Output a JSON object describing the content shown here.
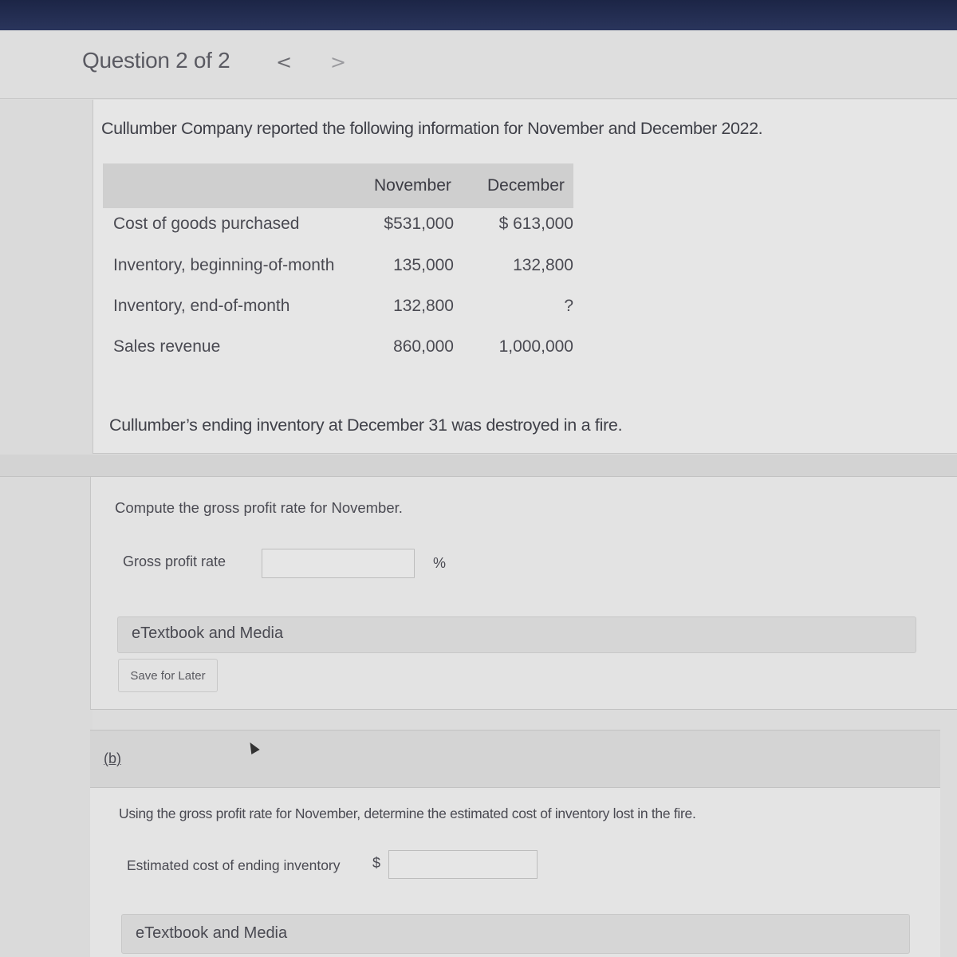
{
  "header": {
    "question_counter": "Question 2 of 2",
    "prev_icon": "<",
    "next_icon": ">"
  },
  "problem": {
    "intro": "Cullumber Company reported the following information for November and December 2022.",
    "table": {
      "columns": [
        "November",
        "December"
      ],
      "rows": [
        {
          "label": "Cost of goods purchased",
          "november": "$531,000",
          "december": "$ 613,000"
        },
        {
          "label": "Inventory, beginning-of-month",
          "november": "135,000",
          "december": "132,800"
        },
        {
          "label": "Inventory, end-of-month",
          "november": "132,800",
          "december": "?"
        },
        {
          "label": "Sales revenue",
          "november": "860,000",
          "december": "1,000,000"
        }
      ]
    },
    "note": "Cullumber’s ending inventory at December 31 was destroyed in a fire."
  },
  "part_a": {
    "prompt": "Compute the gross profit rate for November.",
    "field_label": "Gross profit rate",
    "field_value": "",
    "unit": "%",
    "etextbook_label": "eTextbook and Media",
    "save_label": "Save for Later"
  },
  "part_b": {
    "link_label": "(b)",
    "prompt": "Using the gross profit rate for November, determine the estimated cost of inventory lost in the fire.",
    "field_label": "Estimated cost of ending inventory",
    "currency": "$",
    "field_value": "",
    "etextbook_label": "eTextbook and Media"
  }
}
